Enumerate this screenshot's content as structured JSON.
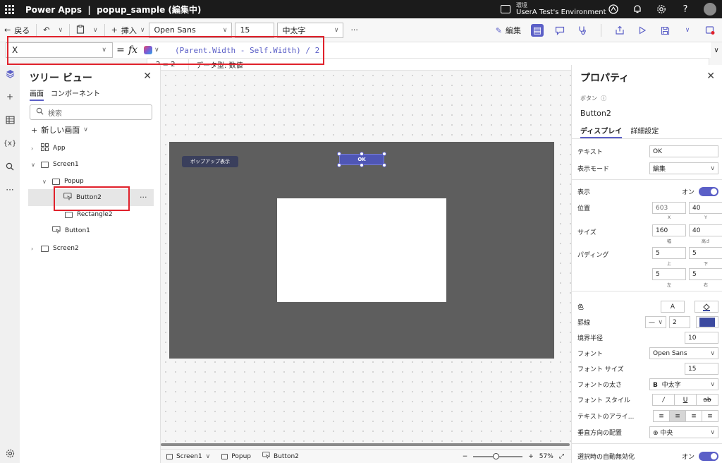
{
  "titlebar": {
    "app_name": "Power Apps",
    "separator": "|",
    "document": "popup_sample (編集中)",
    "env_label": "環境",
    "env_name": "UserA Test's Environment"
  },
  "command_bar": {
    "back": "戻る",
    "insert": "挿入",
    "font_family": "Open Sans",
    "font_size": "15",
    "font_weight": "中太字",
    "more": "···",
    "edit": "編集"
  },
  "formula_bar": {
    "property": "X",
    "equals": "=",
    "fx": "fx",
    "formula": "(Parent.Width - Self.Width) / 2",
    "hint_value": "2 = 2",
    "hint_type": "データ型: 数値"
  },
  "tree_view": {
    "title": "ツリー ビュー",
    "tabs": [
      "画面",
      "コンポーネント"
    ],
    "search_placeholder": "検索",
    "new_screen": "新しい画面",
    "nodes": {
      "app": "App",
      "screen1": "Screen1",
      "popup": "Popup",
      "button2": "Button2",
      "rectangle2": "Rectangle2",
      "button1": "Button1",
      "screen2": "Screen2"
    },
    "more": "···"
  },
  "canvas": {
    "popup_button_label": "ポップアップ表示",
    "ok_button_label": "OK"
  },
  "status_bar": {
    "crumbs": [
      "Screen1",
      "Popup",
      "Button2"
    ],
    "zoom_minus": "−",
    "zoom_plus": "+",
    "zoom_value": "57%",
    "zoom_fraction": 0.45
  },
  "properties": {
    "title": "プロパティ",
    "control_type": "ボタン",
    "control_name": "Button2",
    "tabs": [
      "ディスプレイ",
      "詳細設定"
    ],
    "text_label": "テキスト",
    "text_value": "OK",
    "display_mode_label": "表示モード",
    "display_mode_value": "編集",
    "visible_label": "表示",
    "visible_value": "オン",
    "position_label": "位置",
    "pos_x": "603",
    "pos_y": "40",
    "x_label": "X",
    "y_label": "Y",
    "size_label": "サイズ",
    "width": "160",
    "height": "40",
    "width_label": "幅",
    "height_label": "高さ",
    "padding_label": "パディング",
    "pad_top": "5",
    "pad_bottom": "5",
    "pad_left": "5",
    "pad_right": "5",
    "top_label": "上",
    "bottom_label": "下",
    "left_label": "左",
    "right_label": "右",
    "color_label": "色",
    "color_text_glyph": "A",
    "border_label": "罫線",
    "border_width": "2",
    "border_color": "#3c4aa0",
    "radius_label": "境界半径",
    "radius_value": "10",
    "font_label": "フォント",
    "font_value": "Open Sans",
    "font_size_label": "フォント サイズ",
    "font_size_value": "15",
    "font_weight_label": "フォントの太さ",
    "font_weight_glyph": "B",
    "font_weight_value": "中太字",
    "font_style_label": "フォント スタイル",
    "text_align_label": "テキストのアライ...",
    "valign_label": "垂直方向の配置",
    "valign_value": "中央",
    "auto_disable_label": "選択時の自動無効化",
    "auto_disable_value": "オン"
  },
  "colors": {
    "accent": "#5b5fc7",
    "highlight": "#e0212b",
    "canvas_screen": "#5e5e5e",
    "ok_button": "#4f56b5"
  }
}
